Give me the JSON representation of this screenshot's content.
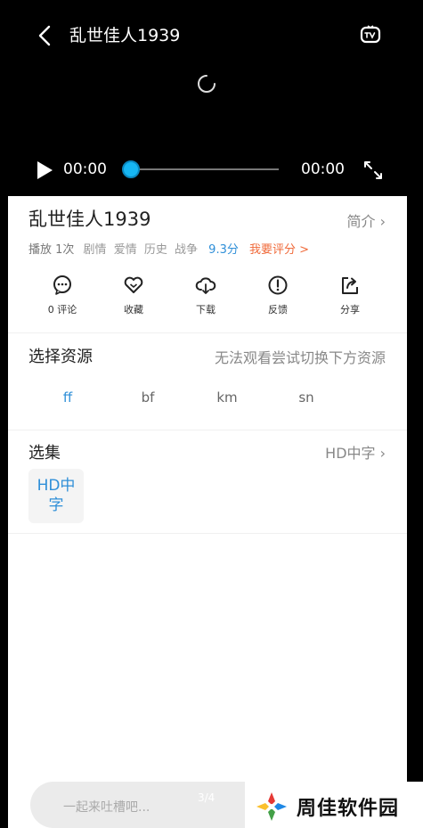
{
  "player": {
    "title": "乱世佳人1939",
    "current_time": "00:00",
    "total_time": "00:00",
    "progress": 0
  },
  "movie": {
    "title": "乱世佳人1939",
    "intro_label": "简介 ›",
    "plays": "播放 1次",
    "tags": [
      "剧情",
      "爱情",
      "历史",
      "战争"
    ],
    "score": "9.3分",
    "rate_label": "我要评分 >"
  },
  "actions": [
    {
      "label": "0 评论",
      "icon": "comment-icon"
    },
    {
      "label": "收藏",
      "icon": "heart-icon"
    },
    {
      "label": "下载",
      "icon": "download-icon"
    },
    {
      "label": "反馈",
      "icon": "feedback-icon"
    },
    {
      "label": "分享",
      "icon": "share-icon"
    }
  ],
  "sources": {
    "title": "选择资源",
    "hint": "无法观看尝试切换下方资源",
    "items": [
      "ff",
      "bf",
      "km",
      "sn"
    ],
    "selected": "ff"
  },
  "episodes": {
    "title": "选集",
    "current": "HD中字 ›",
    "items": [
      "HD中字"
    ]
  },
  "comment": {
    "placeholder": "一起来吐槽吧...",
    "page_indicator": "3/4"
  },
  "watermark": {
    "text": "周佳软件园"
  },
  "colors": {
    "accent": "#2f8fd8",
    "rate": "#f06a3a",
    "seek_knob": "#16b6f3"
  }
}
